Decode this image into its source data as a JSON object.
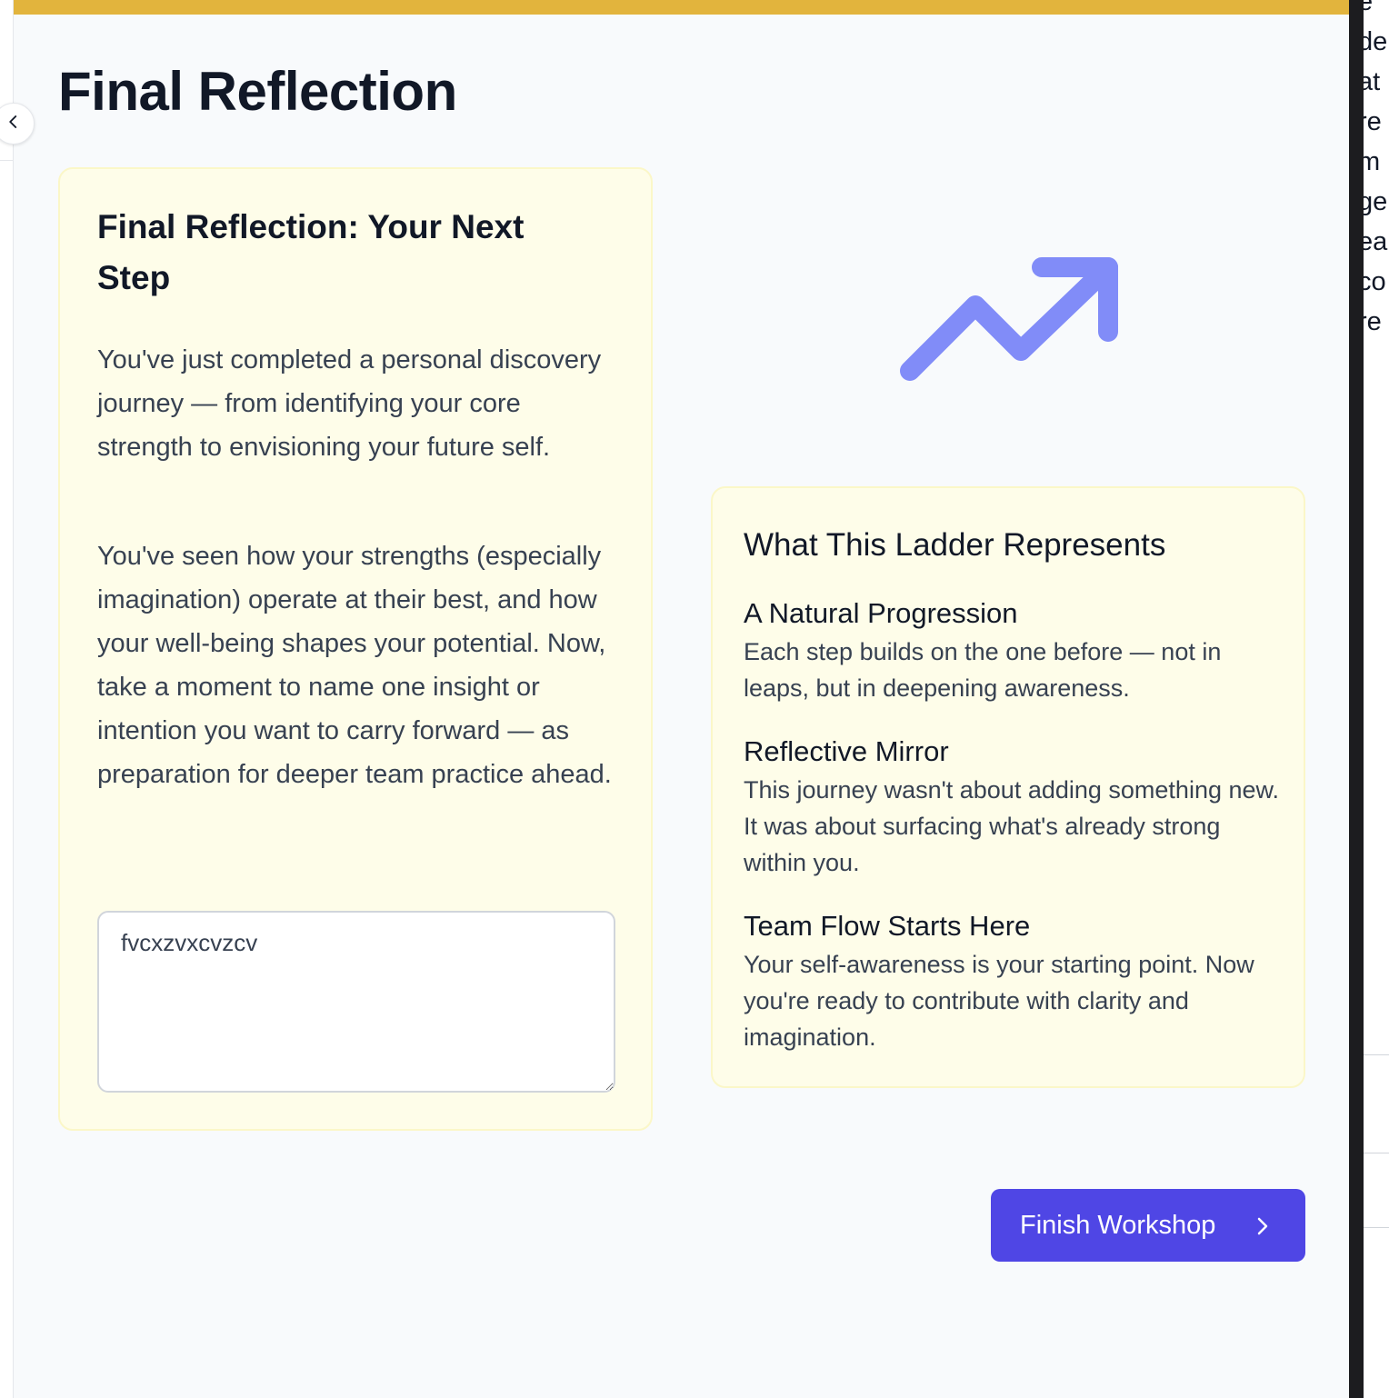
{
  "page": {
    "title": "Final Reflection"
  },
  "reflection_card": {
    "heading": "Final Reflection: Your Next Step",
    "paragraph_1": "You've just completed a personal discovery journey — from identifying your core strength to envisioning your future self.",
    "paragraph_2": "You've seen how your strengths (especially imagination) operate at their best, and how your well-being shapes your potential. Now, take a moment to name one insight or intention you want to carry forward — as preparation for deeper team practice ahead.",
    "textarea_value": "fvcxzvxcvzcv"
  },
  "ladder_card": {
    "heading": "What This Ladder Represents",
    "items": [
      {
        "title": "A Natural Progression",
        "body": "Each step builds on the one before — not in leaps, but in deepening awareness."
      },
      {
        "title": "Reflective Mirror",
        "body": "This journey wasn't about adding something new. It was about surfacing what's already strong within you."
      },
      {
        "title": "Team Flow Starts Here",
        "body": "Your self-awareness is your starting point. Now you're ready to contribute with clarity and imagination."
      }
    ]
  },
  "finish_button": {
    "label": "Finish Workshop"
  },
  "right_panel_fragments": [
    "e",
    "de",
    "at",
    "re",
    "m",
    "ge",
    "ea",
    "co",
    "re"
  ],
  "icons": {
    "collapse": "chevron-left-icon",
    "trend": "trending-up-icon",
    "finish": "chevron-right-icon"
  },
  "colors": {
    "accent_bar": "#e2b43d",
    "card_background": "#fefde9",
    "trend_icon": "#818cf8",
    "primary_button": "#4f46e5"
  }
}
